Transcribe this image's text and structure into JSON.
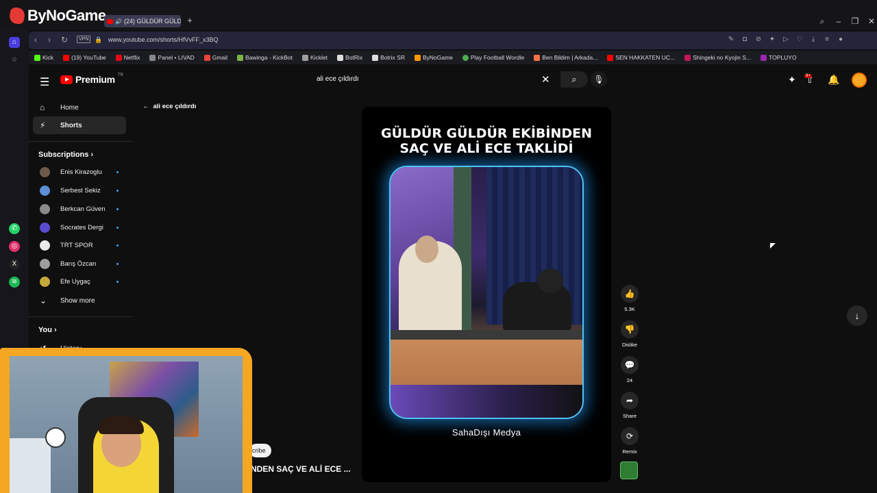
{
  "browser": {
    "brand": "ByNoGame",
    "tab_title": "(24) GÜLDÜR GÜLDÜ",
    "url": "www.youtube.com/shorts/HfVvFF_x3BQ",
    "vpn_label": "VPN",
    "bookmarks": [
      "Kick",
      "(19) YouTube",
      "Netflix",
      "Panel • LIVAD",
      "Gmail",
      "Bawinga - KickBot",
      "Kicklet",
      "BotRix",
      "Botrix SR",
      "ByNoGame",
      "Play Football Wordle",
      "Ben Bildim | Arkada...",
      "SEN HAKKATEN UC...",
      "Shingeki no Kyojin S...",
      "TOPLUYO"
    ]
  },
  "youtube": {
    "logo_text": "Premium",
    "logo_region": "TR",
    "search_query": "ali ece çıldırdı",
    "notification_badge": "9+",
    "nav": {
      "home": "Home",
      "shorts": "Shorts",
      "subscriptions": "Subscriptions",
      "you": "You",
      "history": "History",
      "show_more": "Show more"
    },
    "subscriptions": [
      {
        "name": "Enis Kirazoglu",
        "color": "#6d5a4a"
      },
      {
        "name": "Serbest Sekiz",
        "color": "#5c8fd6"
      },
      {
        "name": "Berkcan Güven",
        "color": "#8a8a8a"
      },
      {
        "name": "Socrates Dergi",
        "color": "#5b4bd1"
      },
      {
        "name": "TRT SPOR",
        "color": "#e8e8e8"
      },
      {
        "name": "Barış Özcan",
        "color": "#9e9e9e"
      },
      {
        "name": "Efe Uygaç",
        "color": "#c5a83a"
      }
    ],
    "back_label": "ali ece çıldırdı",
    "short": {
      "heading_line1": "GÜLDÜR GÜLDÜR EKİBİNDEN",
      "heading_line2": "SAÇ VE ALİ ECE TAKLİDİ",
      "channel_watermark": "SahaDışı Medya",
      "title_partial": "NDEN SAÇ VE ALİ ECE ...",
      "subscribe_partial": "cribe"
    },
    "actions": {
      "like_count": "5.3K",
      "dislike_label": "Dislike",
      "comment_count": "24",
      "share_label": "Share",
      "remix_label": "Remix"
    }
  }
}
